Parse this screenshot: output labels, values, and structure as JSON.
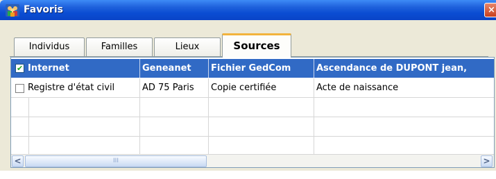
{
  "window": {
    "title": "Favoris",
    "close_label": "×",
    "icon_name": "people-group-icon"
  },
  "tabs": [
    {
      "label": "Individus",
      "active": false
    },
    {
      "label": "Familles",
      "active": false
    },
    {
      "label": "Lieux",
      "active": false
    },
    {
      "label": "Sources",
      "active": true
    }
  ],
  "table": {
    "header_checked": true,
    "columns": [
      "Internet",
      "Geneanet",
      "Fichier GedCom",
      "Ascendance de DUPONT jean,"
    ],
    "rows": [
      {
        "checked": false,
        "cells": [
          "Registre d'état civil",
          "AD 75 Paris",
          "Copie certifiée",
          "Acte de naissance"
        ]
      },
      {
        "checked": null,
        "cells": [
          "",
          "",
          "",
          ""
        ]
      },
      {
        "checked": null,
        "cells": [
          "",
          "",
          "",
          ""
        ]
      },
      {
        "checked": null,
        "cells": [
          "",
          "",
          "",
          ""
        ]
      }
    ]
  },
  "scrollbar": {
    "left_arrow": "<",
    "right_arrow": ">",
    "grip": "III"
  },
  "colors": {
    "titlebar": "#0a4dd3",
    "header_selection": "#316ac5",
    "active_tab_accent": "#f2b33c"
  }
}
